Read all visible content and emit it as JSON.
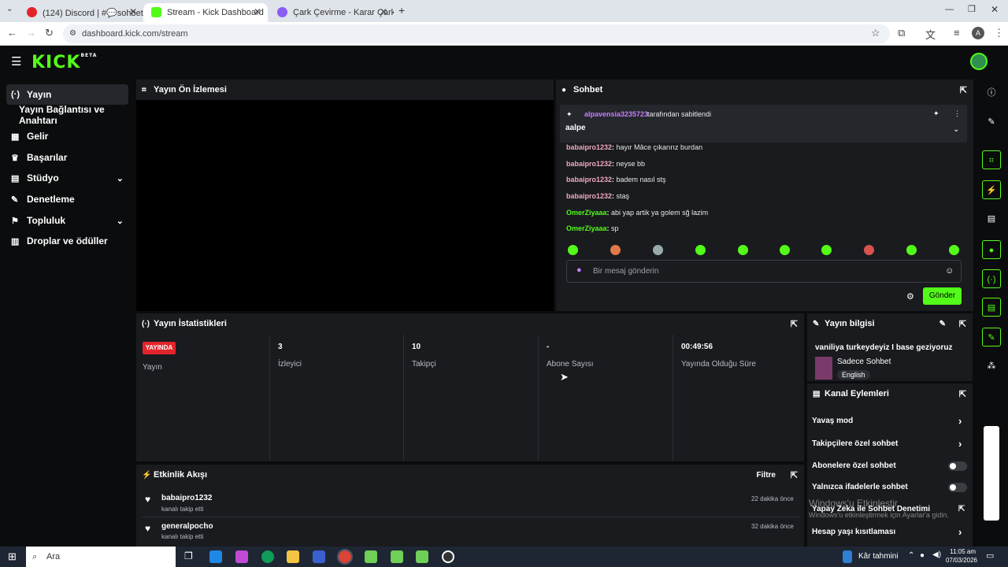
{
  "browser": {
    "tabs": [
      {
        "title": "(124) Discord | #💬sohbet | V..."
      },
      {
        "title": "Stream - Kick Dashboard"
      },
      {
        "title": "Çark Çevirme - Karar Çarkı"
      }
    ],
    "url": "dashboard.kick.com/stream"
  },
  "sidebar": {
    "items": [
      {
        "label": "Yayın"
      },
      {
        "label": "Yayın Bağlantısı ve Anahtarı"
      },
      {
        "label": "Gelir"
      },
      {
        "label": "Başarılar"
      },
      {
        "label": "Stüdyo"
      },
      {
        "label": "Denetleme"
      },
      {
        "label": "Topluluk"
      },
      {
        "label": "Droplar ve ödüller"
      }
    ]
  },
  "preview": {
    "title": "Yayın Ön İzlemesi"
  },
  "chat": {
    "title": "Sohbet",
    "pinned_user": "alpavensia3235723",
    "pinned_suffix": "tarafından sabitlendi",
    "pinned_text": "aalpe",
    "messages": [
      {
        "user": "babaipro1232",
        "text": "hayır Mâce çıkarırız burdan",
        "color": "#f0a8c0"
      },
      {
        "user": "babaipro1232",
        "text": "neyse bb",
        "color": "#f0a8c0"
      },
      {
        "user": "babaipro1232",
        "text": "badem nasıl stş",
        "color": "#f0a8c0"
      },
      {
        "user": "babaipro1232",
        "text": "staş",
        "color": "#f0a8c0"
      },
      {
        "user": "OmerZiyaaa",
        "text": "abi yap artik ya golem sğ lazim",
        "color": "#53fc18"
      },
      {
        "user": "OmerZiyaaa",
        "text": "sp",
        "color": "#53fc18"
      }
    ],
    "placeholder": "Bir mesaj gönderin",
    "send_label": "Gönder"
  },
  "stats": {
    "title": "Yayın İstatistikleri",
    "live_badge": "YAYINDA",
    "live_label": "Yayın",
    "items": [
      {
        "value": "3",
        "label": "İzleyici"
      },
      {
        "value": "10",
        "label": "Takipçi"
      },
      {
        "value": "-",
        "label": "Abone Sayısı"
      },
      {
        "value": "00:49:56",
        "label": "Yayında Olduğu Süre"
      }
    ]
  },
  "activity": {
    "title": "Etkinlik Akışı",
    "filter_label": "Filtre",
    "items": [
      {
        "user": "babaipro1232",
        "action": "kanalı takip etti",
        "time": "22 dakika önce"
      },
      {
        "user": "generalpocho",
        "action": "kanalı takip etti",
        "time": "32 dakika önce"
      }
    ]
  },
  "stream_info": {
    "title": "Yayın bilgisi",
    "stream_title": "vaniliya turkeydeyiz I base geziyoruz",
    "category": "Sadece Sohbet",
    "language": "English"
  },
  "channel_actions": {
    "title": "Kanal Eylemleri",
    "items": [
      {
        "label": "Yavaş mod"
      },
      {
        "label": "Takipçilere özel sohbet"
      },
      {
        "label": "Abonelere özel sohbet"
      },
      {
        "label": "Yalnızca ifadelerle sohbet"
      },
      {
        "label": "Yapay Zeka ile Sohbet Denetimi"
      },
      {
        "label": "Hesap yaşı kısıtlaması"
      }
    ]
  },
  "watermark": {
    "line1": "Windows'u Etkinleştir",
    "line2": "Windows'u etkinleştirmek için Ayarlar'a gidin."
  },
  "taskbar": {
    "search_placeholder": "Ara",
    "weather": "Kâr tahmini",
    "time": "11:05 am",
    "date": "07/03/2026"
  },
  "colors": {
    "accent": "#53fc18",
    "live": "#e3242b"
  }
}
